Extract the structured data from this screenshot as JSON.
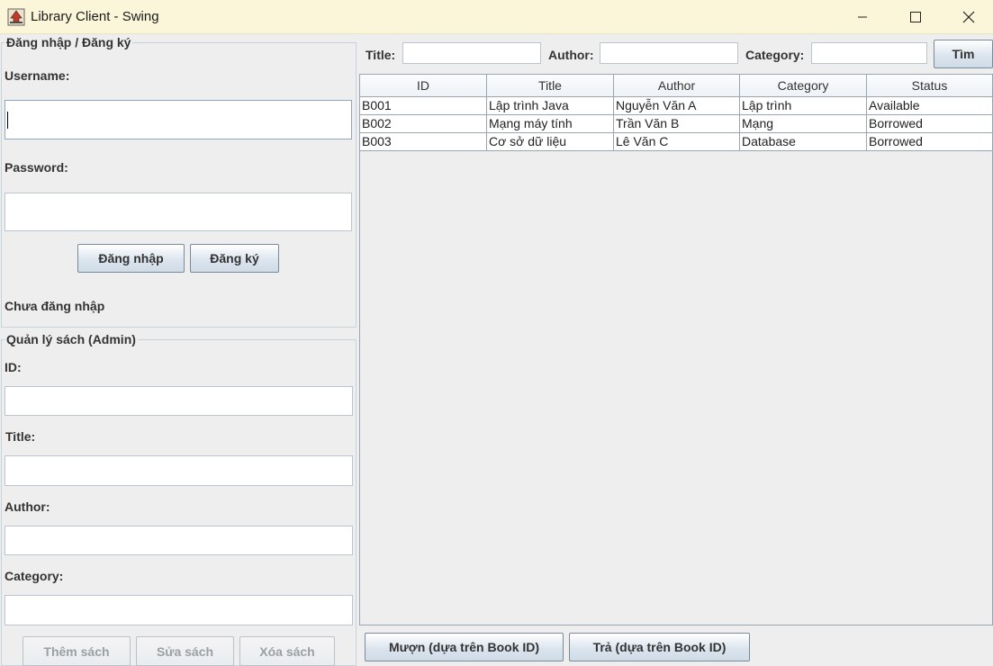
{
  "window": {
    "title": "Library Client - Swing"
  },
  "login": {
    "group_title": "Đăng nhập / Đăng ký",
    "username_label": "Username:",
    "username_value": "",
    "password_label": "Password:",
    "password_value": "",
    "login_button": "Đăng nhập",
    "register_button": "Đăng ký",
    "status": "Chưa đăng nhập"
  },
  "admin": {
    "group_title": "Quản lý sách (Admin)",
    "id_label": "ID:",
    "title_label": "Title:",
    "author_label": "Author:",
    "category_label": "Category:",
    "add_button": "Thêm sách",
    "edit_button": "Sửa sách",
    "delete_button": "Xóa sách"
  },
  "search": {
    "title_label": "Title:",
    "author_label": "Author:",
    "category_label": "Category:",
    "search_button": "Tìm"
  },
  "table": {
    "columns": [
      "ID",
      "Title",
      "Author",
      "Category",
      "Status"
    ],
    "rows": [
      [
        "B001",
        "Lập trình Java",
        "Nguyễn Văn A",
        "Lập trình",
        "Available"
      ],
      [
        "B002",
        "Mạng máy tính",
        "Trần Văn B",
        "Mạng",
        "Borrowed"
      ],
      [
        "B003",
        "Cơ sở dữ liệu",
        "Lê Văn C",
        "Database",
        "Borrowed"
      ]
    ]
  },
  "actions": {
    "borrow_button": "Mượn (dựa trên Book ID)",
    "return_button": "Trả (dựa trên Book ID)"
  },
  "colors": {
    "titlebar": "#fbf6d9",
    "panel_bg": "#eeeeee",
    "border": "#c6d2dc"
  }
}
